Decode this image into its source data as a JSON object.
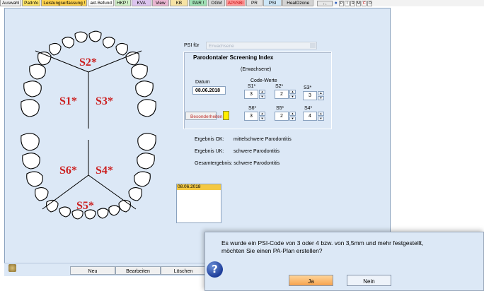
{
  "tabs": [
    {
      "label": "Auswahl",
      "bg": "#f2f2f2"
    },
    {
      "label": "PatInfo",
      "bg": "#ffe566"
    },
    {
      "label": "Leistungserfassung !",
      "bg": "#ffd24d"
    },
    {
      "label": "akt.Befund",
      "bg": "#ffffff"
    },
    {
      "label": "HKP !",
      "bg": "#cfeec6"
    },
    {
      "label": "KVA",
      "bg": "#dcc4ef"
    },
    {
      "label": "View",
      "bg": "#eab6d2"
    },
    {
      "label": "KB",
      "bg": "#f7e3a4"
    },
    {
      "label": "PAR !",
      "bg": "#9fe0b4"
    },
    {
      "label": "OGM",
      "bg": "#d8d8d8"
    },
    {
      "label": "API/SBI",
      "bg": "#ff9c9c"
    },
    {
      "label": "PR",
      "bg": "#e1e1e1"
    },
    {
      "label": "PSI",
      "bg": "#cde6f7"
    },
    {
      "label": "HealOzone",
      "bg": "#d3d3d3"
    }
  ],
  "mini_buttons": [
    "P",
    "I",
    "R",
    "M",
    "C",
    "O"
  ],
  "sextants": {
    "s1": "S1*",
    "s2": "S2*",
    "s3": "S3*",
    "s4": "S4*",
    "s5": "S5*",
    "s6": "S6*"
  },
  "psi_for": {
    "label": "PSI für",
    "value": "Erwachsene"
  },
  "index": {
    "title": "Parodontaler Screening Index",
    "subtitle": "(Erwachsene)",
    "date_label": "Datum",
    "date": "08.06.2018",
    "code_label": "Code-Werte",
    "s1": {
      "label": "S1*",
      "value": "3"
    },
    "s2": {
      "label": "S2*",
      "value": "2"
    },
    "s3": {
      "label": "S3*",
      "value": "3"
    },
    "s6": {
      "label": "S6*",
      "value": "3"
    },
    "s5": {
      "label": "S5*",
      "value": "2"
    },
    "s4": {
      "label": "S4*",
      "value": "4"
    },
    "special_button": "Besonderheiten"
  },
  "results": {
    "ok_label": "Ergebnis OK:",
    "ok_value": "mittelschwere Parodontitis",
    "uk_label": "Ergebnis UK:",
    "uk_value": "schwere Parodontitis",
    "total": "Gesamtergebnis: schwere Parodontitis"
  },
  "date_list": [
    "08.06.2018"
  ],
  "bottom_buttons": {
    "new": "Neu",
    "edit": "Bearbeiten",
    "delete": "Löschen"
  },
  "dialog": {
    "line1": "Es wurde ein PSI-Code von 3 oder 4 bzw. von 3,5mm und mehr festgestellt,",
    "line2": "möchten Sie einen PA-Plan erstellen?",
    "yes": "Ja",
    "no": "Nein"
  },
  "colors": {
    "accent_red": "#cc1f1f",
    "window_bg": "#dce8f6",
    "selected_item": "#f4c842"
  }
}
